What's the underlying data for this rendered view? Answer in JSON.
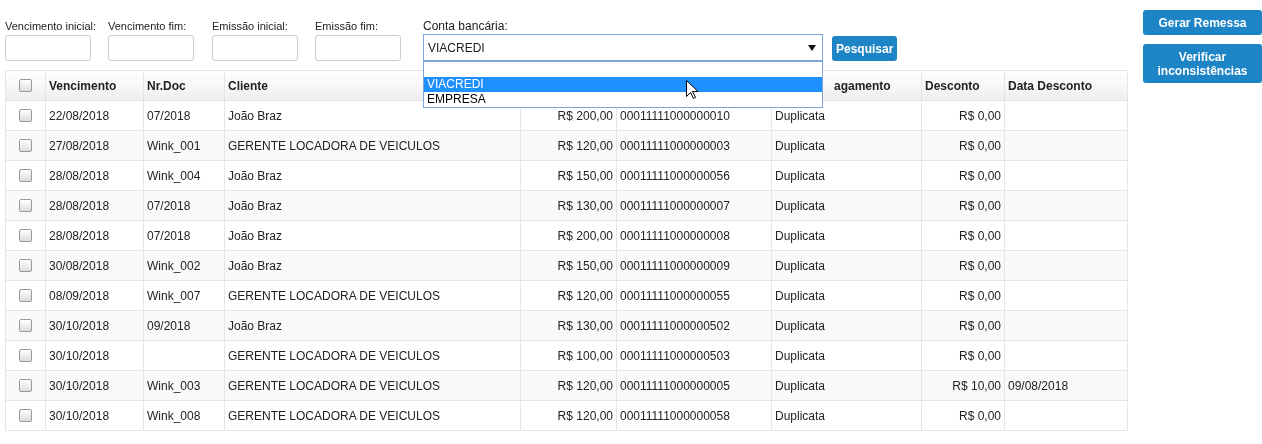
{
  "filters": [
    {
      "label": "Vencimento inicial:"
    },
    {
      "label": "Vencimento fim:"
    },
    {
      "label": "Emissão inicial:"
    },
    {
      "label": "Emissão fim:"
    }
  ],
  "account": {
    "label": "Conta bancária:",
    "value": "VIACREDI",
    "expanded": true,
    "options": [
      {
        "label": "VIACREDI",
        "selected": true
      },
      {
        "label": "EMPRESA",
        "selected": false
      }
    ]
  },
  "search_button": "Pesquisar",
  "side_buttons": [
    "Gerar Remessa",
    "Verificar inconsistências"
  ],
  "table": {
    "all_checked": false,
    "columns": [
      "Vencimento",
      "Nr.Doc",
      "Cliente",
      "",
      "",
      "agamento",
      "Desconto",
      "Data Desconto"
    ],
    "rows": [
      {
        "checked": false,
        "cells": [
          "22/08/2018",
          "07/2018",
          "João Braz",
          "R$ 200,00",
          "00011111000000010",
          "Duplicata",
          "R$ 0,00",
          ""
        ]
      },
      {
        "checked": false,
        "cells": [
          "27/08/2018",
          "Wink_001",
          "GERENTE LOCADORA DE VEICULOS",
          "R$ 120,00",
          "00011111000000003",
          "Duplicata",
          "R$ 0,00",
          ""
        ]
      },
      {
        "checked": false,
        "cells": [
          "28/08/2018",
          "Wink_004",
          "João Braz",
          "R$ 150,00",
          "00011111000000056",
          "Duplicata",
          "R$ 0,00",
          ""
        ]
      },
      {
        "checked": false,
        "cells": [
          "28/08/2018",
          "07/2018",
          "João Braz",
          "R$ 130,00",
          "00011111000000007",
          "Duplicata",
          "R$ 0,00",
          ""
        ]
      },
      {
        "checked": false,
        "cells": [
          "28/08/2018",
          "07/2018",
          "João Braz",
          "R$ 200,00",
          "00011111000000008",
          "Duplicata",
          "R$ 0,00",
          ""
        ]
      },
      {
        "checked": false,
        "cells": [
          "30/08/2018",
          "Wink_002",
          "João Braz",
          "R$ 150,00",
          "00011111000000009",
          "Duplicata",
          "R$ 0,00",
          ""
        ]
      },
      {
        "checked": false,
        "cells": [
          "08/09/2018",
          "Wink_007",
          "GERENTE LOCADORA DE VEICULOS",
          "R$ 120,00",
          "00011111000000055",
          "Duplicata",
          "R$ 0,00",
          ""
        ]
      },
      {
        "checked": false,
        "cells": [
          "30/10/2018",
          "09/2018",
          "João Braz",
          "R$ 130,00",
          "00011111000000502",
          "Duplicata",
          "R$ 0,00",
          ""
        ]
      },
      {
        "checked": false,
        "cells": [
          "30/10/2018",
          "",
          "GERENTE LOCADORA DE VEICULOS",
          "R$ 100,00",
          "00011111000000503",
          "Duplicata",
          "R$ 0,00",
          ""
        ]
      },
      {
        "checked": false,
        "cells": [
          "30/10/2018",
          "Wink_003",
          "GERENTE LOCADORA DE VEICULOS",
          "R$ 120,00",
          "00011111000000005",
          "Duplicata",
          "R$ 10,00",
          "09/08/2018"
        ]
      },
      {
        "checked": false,
        "cells": [
          "30/10/2018",
          "Wink_008",
          "GERENTE LOCADORA DE VEICULOS",
          "R$ 120,00",
          "00011111000000058",
          "Duplicata",
          "R$ 0,00",
          ""
        ]
      }
    ]
  }
}
